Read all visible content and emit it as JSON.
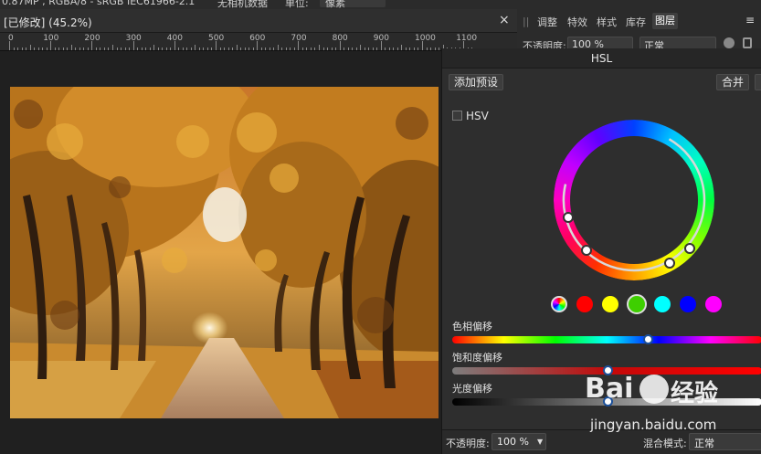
{
  "topbar": {
    "info": "0.87MP , RGBA/8 - sRGB IEC61966-2.1",
    "meta": "无相机数据",
    "unit_label": "单位:",
    "unit_value": "像素"
  },
  "document": {
    "title": "[已修改] (45.2%)",
    "close": "×"
  },
  "ruler": {
    "labels": [
      "0",
      "100",
      "200",
      "300",
      "400",
      "500",
      "600",
      "700",
      "800",
      "900",
      "1000",
      "1100"
    ]
  },
  "right_tabs": {
    "grip": "||",
    "tabs": [
      "调整",
      "特效",
      "样式",
      "库存",
      "图层"
    ],
    "active": "图层",
    "menu_icon": "≡"
  },
  "layer_bar": {
    "opacity_label": "不透明度:",
    "opacity_value": "100 %",
    "blend_value": "正常"
  },
  "hsl_panel": {
    "title": "HSL",
    "add_preset": "添加预设",
    "merge": "合并",
    "hsv_label": "HSV",
    "swatches": [
      "master",
      "#ff0000",
      "#ffff00",
      "#00ff00",
      "#00ffff",
      "#0000ff",
      "#ff00ff"
    ],
    "selected_swatch": 3,
    "hue_label": "色相偏移",
    "hue_value": 0.63,
    "saturation_label": "饱和度偏移",
    "saturation_value": 0.5,
    "luminosity_label": "光度偏移",
    "luminosity_value": 0.5,
    "bottom_opacity_label": "不透明度:",
    "bottom_opacity_value": "100 %",
    "blend_mode_label": "混合模式:",
    "blend_mode_value": "正常"
  },
  "watermark": {
    "brand_text": "Bai",
    "brand_suffix": "经验",
    "url": "jingyan.baidu.com"
  },
  "colors": {
    "accent_knob": "#1a4f9a",
    "panel_bg": "#2e2e2e"
  }
}
